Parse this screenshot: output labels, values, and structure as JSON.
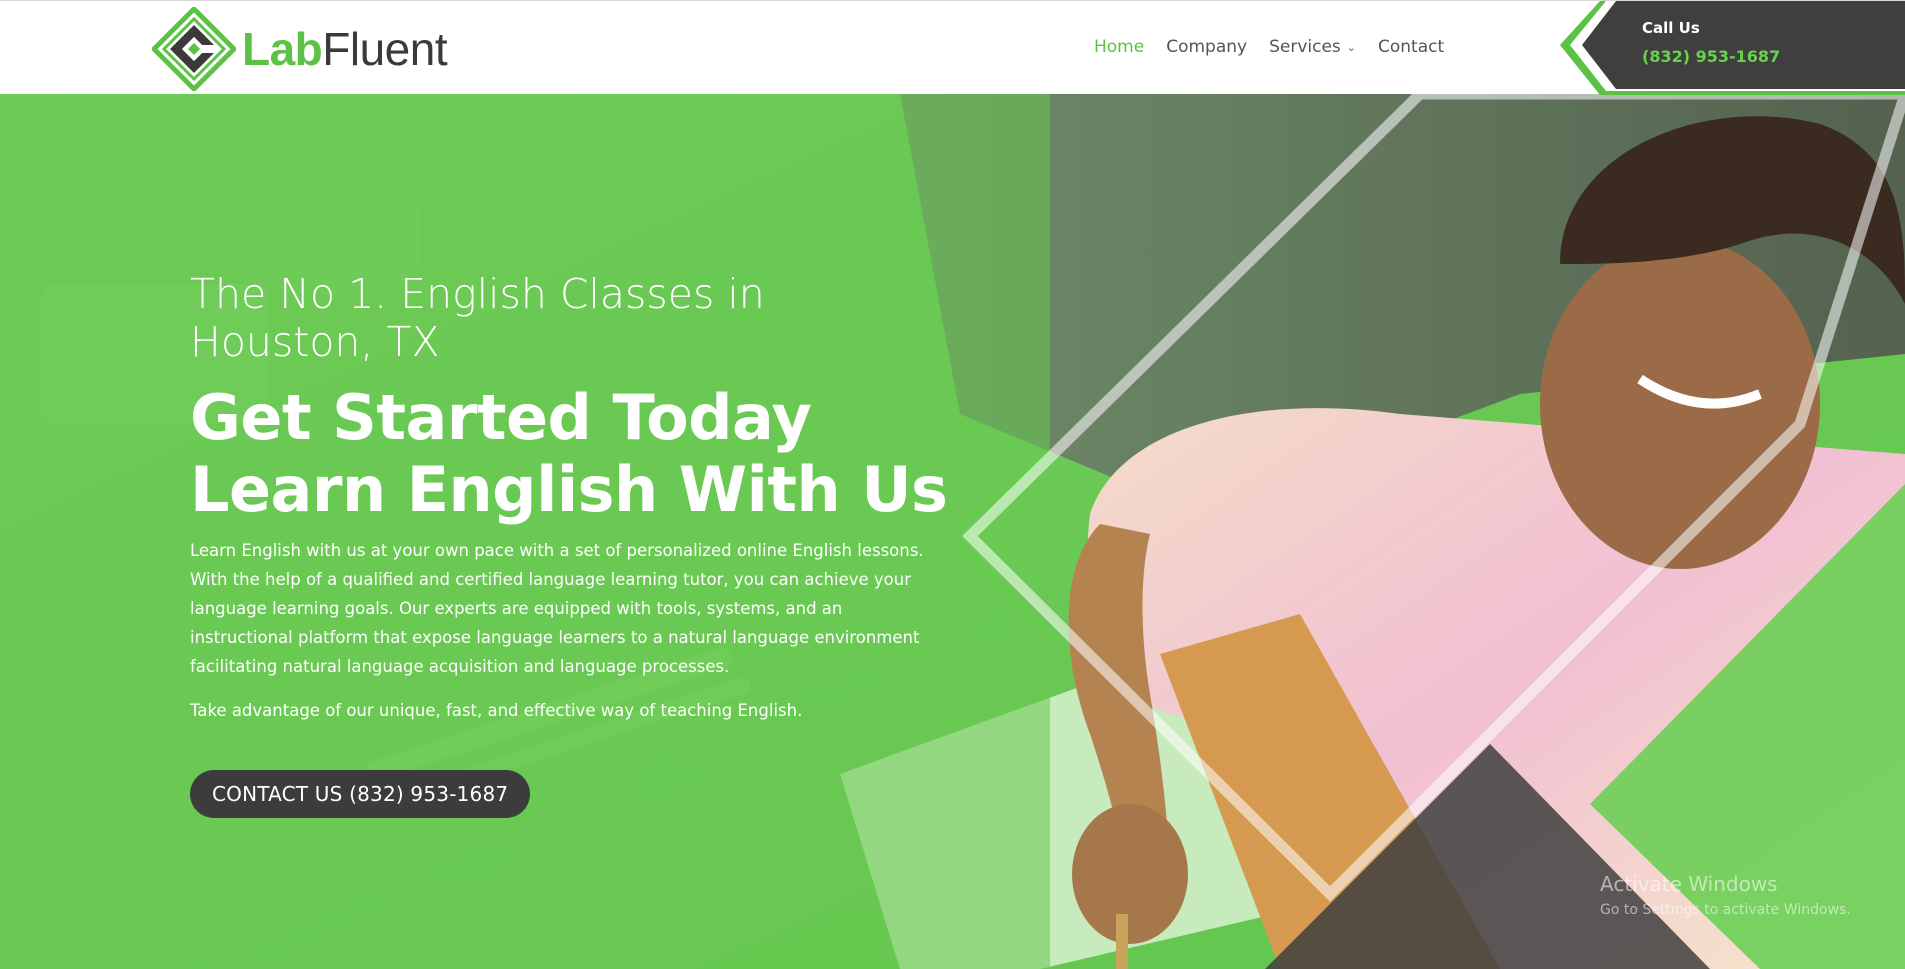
{
  "header": {
    "logo": {
      "part1": "Lab",
      "part2": "Fluent"
    },
    "nav": [
      {
        "label": "Home",
        "active": true
      },
      {
        "label": "Company",
        "active": false
      },
      {
        "label": "Services",
        "active": false
      },
      {
        "label": "Contact",
        "active": false
      }
    ],
    "call": {
      "label": "Call Us",
      "phone": "(832) 953-1687"
    }
  },
  "hero": {
    "eyebrow": "The No 1. English Classes in Houston, TX",
    "headline_line1": "Get Started Today",
    "headline_line2": "Learn English With Us",
    "body": "Learn English with us at your own pace with a set of personalized online English lessons. With the help of a qualified and certified language learning tutor, you can achieve your language learning goals. Our experts are equipped with tools, systems, and an instructional platform that expose language learners to a natural language environment facilitating natural language acquisition and language processes.",
    "body2": "Take advantage of our unique, fast, and effective way of teaching English.",
    "cta": "CONTACT US (832) 953-1687"
  },
  "watermark": {
    "line1": "Activate Windows",
    "line2": "Go to Settings to activate Windows."
  },
  "colors": {
    "brand_green": "#5cc245",
    "dark": "#3c3c3c",
    "nav_text": "#555555"
  },
  "icons": [
    "logo-diamond-icon",
    "chevron-down-icon"
  ]
}
